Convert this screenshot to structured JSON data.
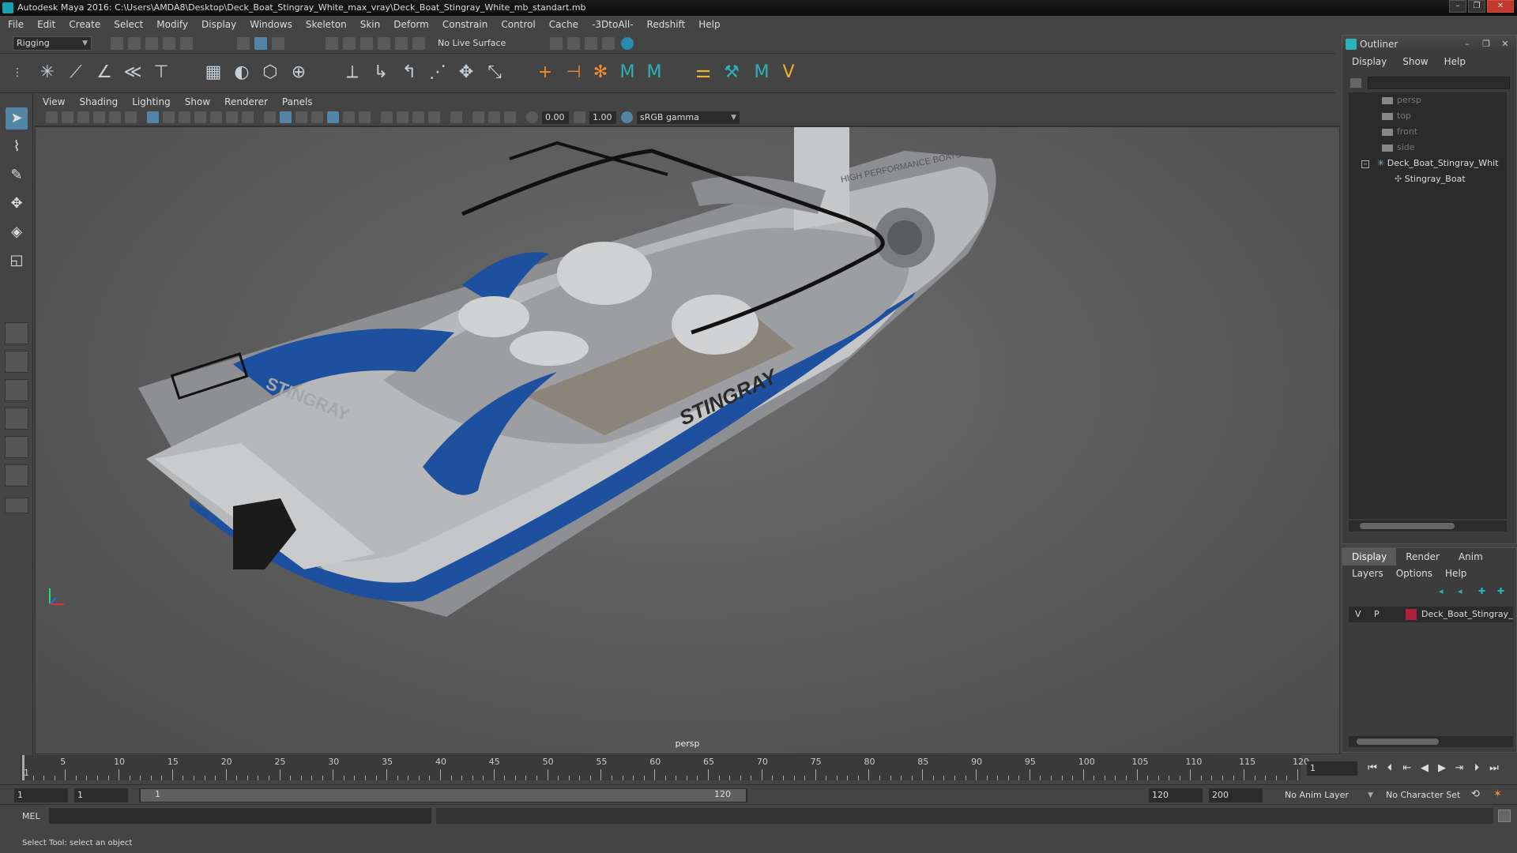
{
  "window": {
    "title": "Autodesk Maya 2016: C:\\Users\\AMDA8\\Desktop\\Deck_Boat_Stingray_White_max_vray\\Deck_Boat_Stingray_White_mb_standart.mb"
  },
  "menubar": [
    "File",
    "Edit",
    "Create",
    "Select",
    "Modify",
    "Display",
    "Windows",
    "Skeleton",
    "Skin",
    "Deform",
    "Constrain",
    "Control",
    "Cache",
    "-3DtoAll-",
    "Redshift",
    "Help"
  ],
  "statusline": {
    "mode": "Rigging",
    "live_surface": "No Live Surface"
  },
  "viewport": {
    "menu": [
      "View",
      "Shading",
      "Lighting",
      "Show",
      "Renderer",
      "Panels"
    ],
    "exposure": "0.00",
    "gamma": "1.00",
    "color_space": "sRGB gamma",
    "camera_label": "persp",
    "boat_text_hull": "STINGRAY",
    "boat_text_transom": "STINGRAY",
    "boat_text_deck": "HIGH PERFORMANCE BOATS",
    "accent_color": "#1e50a0"
  },
  "outliner": {
    "title": "Outliner",
    "menu": [
      "Display",
      "Show",
      "Help"
    ],
    "items": [
      "persp",
      "top",
      "front",
      "side",
      "Deck_Boat_Stingray_Whit",
      "Stingray_Boat"
    ]
  },
  "layers": {
    "tabs": [
      "Display",
      "Render",
      "Anim"
    ],
    "menu": [
      "Layers",
      "Options",
      "Help"
    ],
    "row": {
      "v": "V",
      "p": "P",
      "name": "Deck_Boat_Stingray_W",
      "color": "#b0203a"
    }
  },
  "timeline": {
    "ticks": [
      "1",
      "5",
      "10",
      "15",
      "20",
      "25",
      "30",
      "35",
      "40",
      "45",
      "50",
      "55",
      "60",
      "65",
      "70",
      "75",
      "80",
      "85",
      "90",
      "95",
      "100",
      "105",
      "110",
      "115",
      "120"
    ],
    "current_frame": "1"
  },
  "range": {
    "start": "1",
    "playback_start": "1",
    "slider_start": "1",
    "slider_end": "120",
    "playback_end": "120",
    "end": "200",
    "anim_layer": "No Anim Layer",
    "character_set": "No Character Set"
  },
  "command": {
    "lang": "MEL"
  },
  "helpline": "Select Tool: select an object"
}
